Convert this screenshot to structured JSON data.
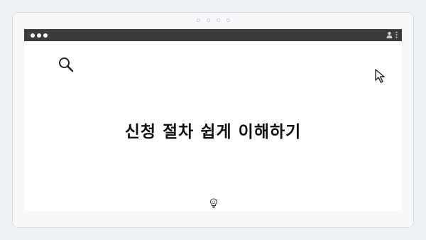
{
  "window": {
    "title_controls": [
      "close",
      "minimize",
      "maximize"
    ]
  },
  "icons": {
    "search": "search-icon",
    "cursor": "cursor-arrow-icon",
    "user": "user-icon",
    "menu": "kebab-menu-icon",
    "bulb": "lightbulb-icon"
  },
  "content": {
    "headline": "신청 절차 쉽게 이해하기"
  },
  "colors": {
    "titlebar": "#3b3b3b",
    "background": "#eef1f4",
    "window": "#ffffff",
    "text": "#111111"
  }
}
